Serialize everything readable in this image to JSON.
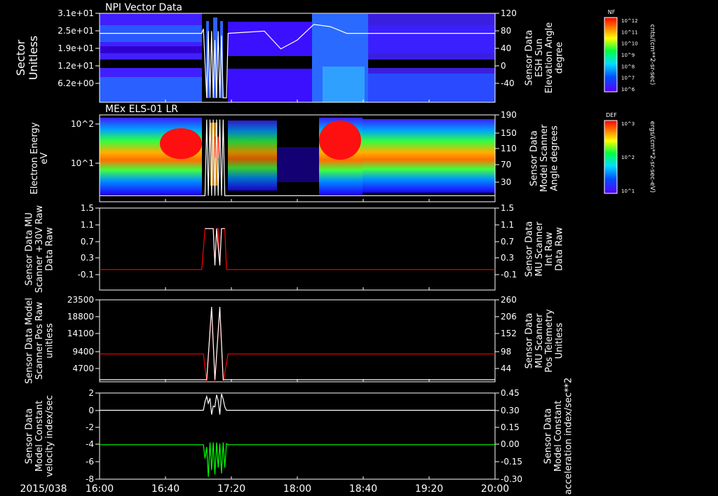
{
  "date_label": "2015/038",
  "time_axis": {
    "ticks": [
      "16:00",
      "16:40",
      "17:20",
      "18:00",
      "18:40",
      "19:20",
      "20:00"
    ],
    "start": "16:00",
    "end": "20:00"
  },
  "colors": {
    "background": "#000000",
    "frame": "#ffffff",
    "red_series": "#ff0000",
    "green_series": "#00ff00",
    "white_series": "#ffffff"
  },
  "colorbars": [
    {
      "id": "nf",
      "title": "NF",
      "unit": "cnts/(cm**2-sr-sec)",
      "tick_labels": [
        "10^12",
        "10^11",
        "10^10",
        "10^9",
        "10^8",
        "10^7",
        "10^6"
      ]
    },
    {
      "id": "def",
      "title": "DEF",
      "unit": "ergs/(cm**2-sr-sec-eV)",
      "tick_labels": [
        "10^3",
        "10^2",
        "10^1"
      ]
    }
  ],
  "chart_data": [
    {
      "type": "heatmap",
      "title": "NPI Vector Data",
      "ylabel": "Sector Unitless",
      "ytick_labels": [
        "3.1e+01",
        "2.5e+01",
        "1.9e+01",
        "1.2e+01",
        "6.2e+00"
      ],
      "y2label": "Sensor Data ESH Sun Elevation Angle degree",
      "y2tick_labels": [
        "120",
        "80",
        "40",
        "0",
        "-40"
      ],
      "y2lim": [
        -80,
        120
      ],
      "colorbar": "nf",
      "line_series": {
        "color": "white",
        "x": [
          "16:00",
          "17:02",
          "17:03",
          "17:04",
          "17:05",
          "17:06",
          "17:07",
          "17:08",
          "17:09",
          "17:10",
          "17:11",
          "17:12",
          "17:13",
          "17:14",
          "17:15",
          "17:16",
          "17:17",
          "17:18",
          "17:40",
          "17:50",
          "18:00",
          "18:10",
          "18:20",
          "18:30",
          "18:40",
          "20:00"
        ],
        "y": [
          75,
          75,
          85,
          10,
          -70,
          80,
          -70,
          80,
          -70,
          60,
          -70,
          80,
          -70,
          70,
          -70,
          -70,
          -70,
          75,
          80,
          40,
          60,
          95,
          90,
          75,
          75,
          75
        ]
      }
    },
    {
      "type": "heatmap",
      "title": "MEx ELS-01 LR",
      "ylabel": "Electron Energy eV",
      "ytick_labels": [
        "10^2",
        "10^1"
      ],
      "y2label": "Sensor Data Model Scanner Angle degrees",
      "y2tick_labels": [
        "190",
        "150",
        "110",
        "70",
        "30"
      ],
      "y2lim": [
        5,
        190
      ],
      "colorbar": "def",
      "line_series": {
        "color": "white",
        "x": [
          "16:00",
          "17:04",
          "17:05",
          "17:06",
          "17:07",
          "17:08",
          "17:09",
          "17:10",
          "17:11",
          "17:12",
          "17:13",
          "17:14",
          "17:15",
          "17:16",
          "17:17",
          "17:18",
          "20:00"
        ],
        "y": [
          18,
          18,
          180,
          18,
          180,
          18,
          180,
          18,
          180,
          18,
          180,
          18,
          180,
          18,
          18,
          18,
          18
        ]
      }
    },
    {
      "type": "line",
      "ylabel": "Sensor Data MU Scanner +30V Raw Data Raw",
      "ytick_labels": [
        "1.5",
        "1.1",
        "0.7",
        "0.3",
        "-0.1"
      ],
      "ylim": [
        -0.5,
        1.5
      ],
      "y2label": "Sensor Data MU Scanner Int Raw Data Raw",
      "y2tick_labels": [
        "1.5",
        "1.1",
        "0.7",
        "0.3",
        "-0.1"
      ],
      "y2lim": [
        -0.5,
        1.5
      ],
      "series": [
        {
          "color": "red",
          "x": [
            "16:00",
            "17:02",
            "17:04",
            "17:09",
            "17:10",
            "17:11",
            "17:12",
            "17:13",
            "17:14",
            "17:15",
            "17:16",
            "17:17",
            "17:18",
            "20:00"
          ],
          "y": [
            0,
            0,
            1,
            1,
            0.1,
            1,
            1,
            0.1,
            1,
            1,
            1,
            0,
            0,
            0
          ]
        },
        {
          "color": "white",
          "x": [
            "17:04",
            "17:09",
            "17:10",
            "17:11",
            "17:13",
            "17:14",
            "17:16"
          ],
          "y": [
            1,
            1,
            0.1,
            1,
            0.1,
            1,
            1
          ]
        }
      ]
    },
    {
      "type": "line",
      "ylabel": "Sensor Data Model Scanner Pos Raw unitless",
      "ytick_labels": [
        "23500",
        "18800",
        "14100",
        "9400",
        "4700"
      ],
      "ylim": [
        0,
        23500
      ],
      "y2label": "Sensor Data MU Scanner Pos Telemetry Unitless",
      "y2tick_labels": [
        "260",
        "206",
        "152",
        "98",
        "44"
      ],
      "y2lim": [
        -10,
        260
      ],
      "series": [
        {
          "color": "red",
          "x": [
            "16:00",
            "17:03",
            "17:05",
            "17:08",
            "17:10",
            "17:13",
            "17:15",
            "17:18",
            "20:00"
          ],
          "y": [
            8000,
            8000,
            0,
            21000,
            0,
            21000,
            0,
            8000,
            8000
          ]
        },
        {
          "color": "white",
          "x": [
            "16:00",
            "17:03",
            "17:05",
            "17:08",
            "17:10",
            "17:13",
            "17:15",
            "17:18",
            "20:00"
          ],
          "y": [
            600,
            600,
            600,
            21500,
            600,
            21500,
            600,
            600,
            600
          ]
        }
      ]
    },
    {
      "type": "line",
      "ylabel": "Sensor Data Model Constant velocity index/sec",
      "ytick_labels": [
        "2",
        "0",
        "-2",
        "-4",
        "-6",
        "-8"
      ],
      "ylim": [
        -8,
        2
      ],
      "y2label": "Sensor Data Model Constant acceleration index/sec**2",
      "y2tick_labels": [
        "0.45",
        "0.30",
        "0.15",
        "0.00",
        "-0.15",
        "-0.30"
      ],
      "y2lim": [
        -0.3,
        0.45
      ],
      "series": [
        {
          "color": "white",
          "x": [
            "16:00",
            "17:03",
            "17:04",
            "17:05",
            "17:06",
            "17:07",
            "17:08",
            "17:09",
            "17:10",
            "17:11",
            "17:12",
            "17:13",
            "17:14",
            "17:15",
            "17:16",
            "17:17",
            "17:18",
            "20:00"
          ],
          "y": [
            0,
            0,
            1,
            1.6,
            0.8,
            1.4,
            -0.5,
            0.5,
            0.4,
            1.8,
            1.1,
            -0.5,
            1.9,
            1.3,
            0.4,
            0,
            0,
            0
          ]
        },
        {
          "color": "green",
          "x": [
            "16:00",
            "17:03",
            "17:04",
            "17:05",
            "17:06",
            "17:07",
            "17:08",
            "17:09",
            "17:10",
            "17:11",
            "17:12",
            "17:13",
            "17:14",
            "17:15",
            "17:16",
            "17:17",
            "17:18",
            "20:00"
          ],
          "y": [
            0,
            0,
            -0.12,
            -0.02,
            -0.28,
            0.02,
            -0.22,
            0.02,
            -0.26,
            0.02,
            -0.2,
            0.01,
            -0.25,
            0.02,
            -0.2,
            0.01,
            0,
            0
          ]
        }
      ]
    }
  ]
}
